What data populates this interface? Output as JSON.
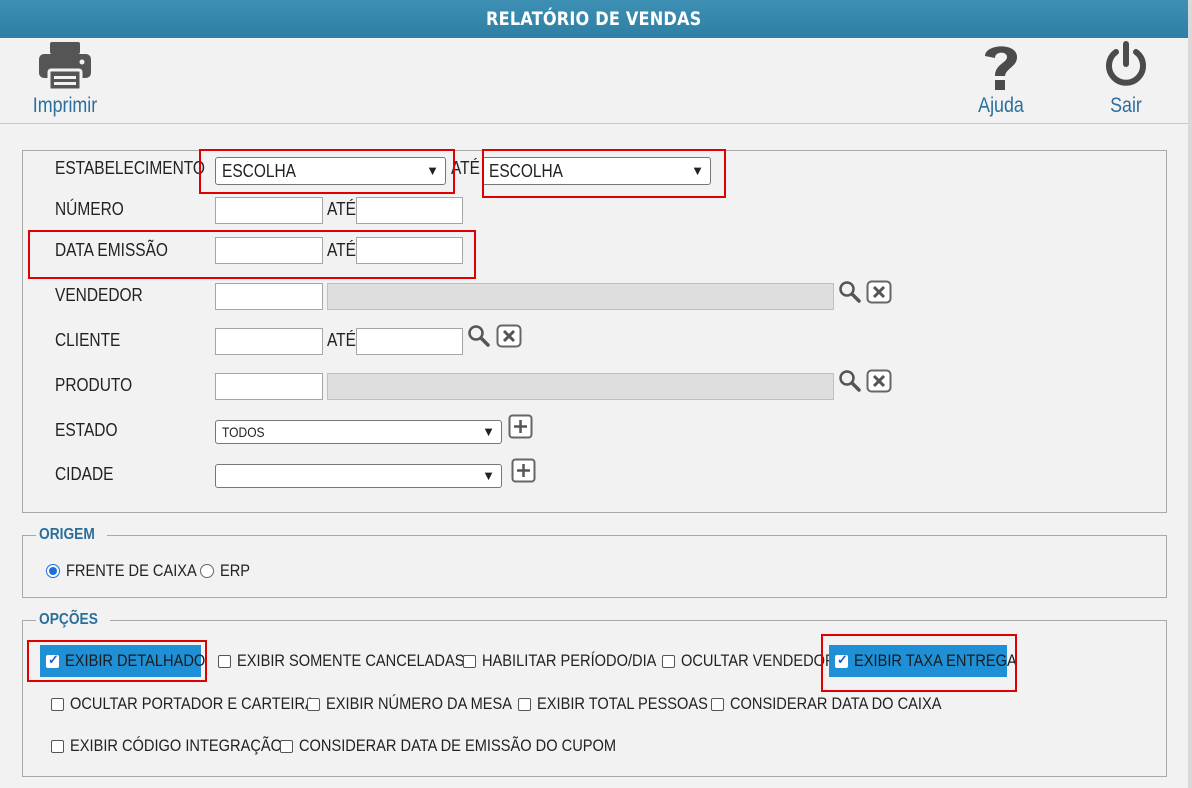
{
  "title": "RELATÓRIO DE VENDAS",
  "toolbar": {
    "print": "Imprimir",
    "help": "Ajuda",
    "exit": "Sair"
  },
  "filters": {
    "estabelecimento": {
      "label": "ESTABELECIMENTO",
      "from": "ESCOLHA",
      "ate": "ATÉ",
      "to": "ESCOLHA"
    },
    "numero": {
      "label": "NÚMERO",
      "ate": "ATÉ"
    },
    "data_emissao": {
      "label": "DATA EMISSÃO",
      "ate": "ATÉ"
    },
    "vendedor": {
      "label": "VENDEDOR"
    },
    "cliente": {
      "label": "CLIENTE",
      "ate": "ATÉ"
    },
    "produto": {
      "label": "PRODUTO"
    },
    "estado": {
      "label": "ESTADO",
      "value": "TODOS"
    },
    "cidade": {
      "label": "CIDADE",
      "value": ""
    }
  },
  "origem": {
    "legend": "ORIGEM",
    "options": [
      {
        "label": "FRENTE DE CAIXA",
        "selected": true
      },
      {
        "label": "ERP",
        "selected": false
      }
    ]
  },
  "opcoes": {
    "legend": "OPÇÕES",
    "items": [
      {
        "label": "EXIBIR DETALHADO",
        "checked": true
      },
      {
        "label": "EXIBIR SOMENTE CANCELADAS",
        "checked": false
      },
      {
        "label": "HABILITAR PERÍODO/DIA",
        "checked": false
      },
      {
        "label": "OCULTAR VENDEDOR",
        "checked": false
      },
      {
        "label": "EXIBIR TAXA ENTREGA",
        "checked": true
      },
      {
        "label": "OCULTAR PORTADOR E CARTEIRA",
        "checked": false
      },
      {
        "label": "EXIBIR NÚMERO DA MESA",
        "checked": false
      },
      {
        "label": "EXIBIR TOTAL PESSOAS",
        "checked": false
      },
      {
        "label": "CONSIDERAR DATA DO CAIXA",
        "checked": false
      },
      {
        "label": "EXIBIR CÓDIGO INTEGRAÇÃO",
        "checked": false
      },
      {
        "label": "CONSIDERAR DATA DE EMISSÃO DO CUPOM",
        "checked": false
      }
    ]
  },
  "colors": {
    "title_bar": "#2d7fa5",
    "accent_text": "#2a6f9c",
    "highlight": "#1f8fd6",
    "annotation_red": "#e00000"
  }
}
